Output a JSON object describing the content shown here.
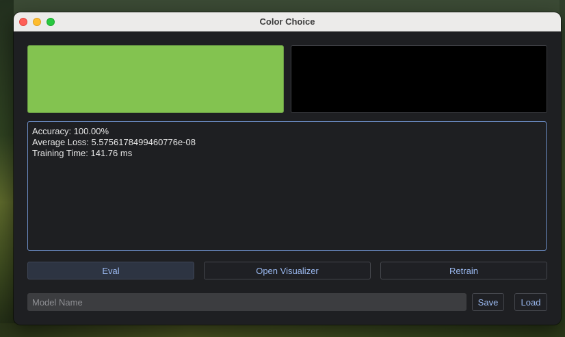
{
  "window": {
    "title": "Color Choice"
  },
  "swatches": {
    "left_color": "#83c350",
    "right_color": "#000000"
  },
  "output": {
    "lines": [
      "Accuracy: 100.00%",
      "Average Loss: 5.5756178499460776e-08",
      "Training Time: 141.76 ms"
    ]
  },
  "buttons": {
    "eval_label": "Eval",
    "visualizer_label": "Open Visualizer",
    "retrain_label": "Retrain",
    "save_label": "Save",
    "load_label": "Load"
  },
  "model_name": {
    "value": "",
    "placeholder": "Model Name"
  },
  "colors": {
    "accent_text": "#9ab8ef",
    "focus_border": "#6d8fc9",
    "window_bg": "#1e1f22"
  }
}
